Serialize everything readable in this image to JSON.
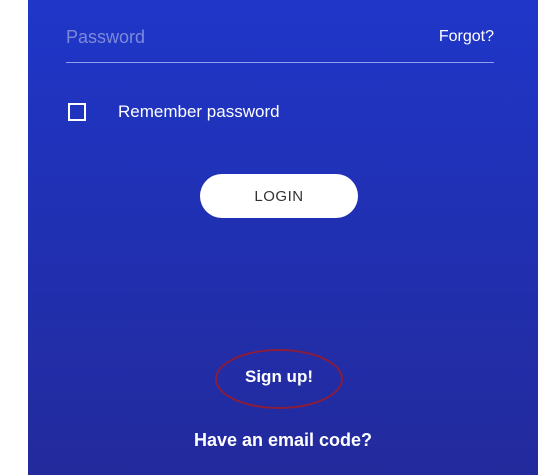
{
  "login_form": {
    "password": {
      "placeholder": "Password",
      "value": ""
    },
    "forgot_label": "Forgot?",
    "remember": {
      "label": "Remember password",
      "checked": false
    },
    "login_label": "LOGIN",
    "signup_label": "Sign up!",
    "email_code_label": "Have an email code?"
  },
  "colors": {
    "background_top": "#1f36c9",
    "background_bottom": "#232a9c",
    "annotation_circle": "#8b1c3a",
    "button_background": "#ffffff"
  }
}
